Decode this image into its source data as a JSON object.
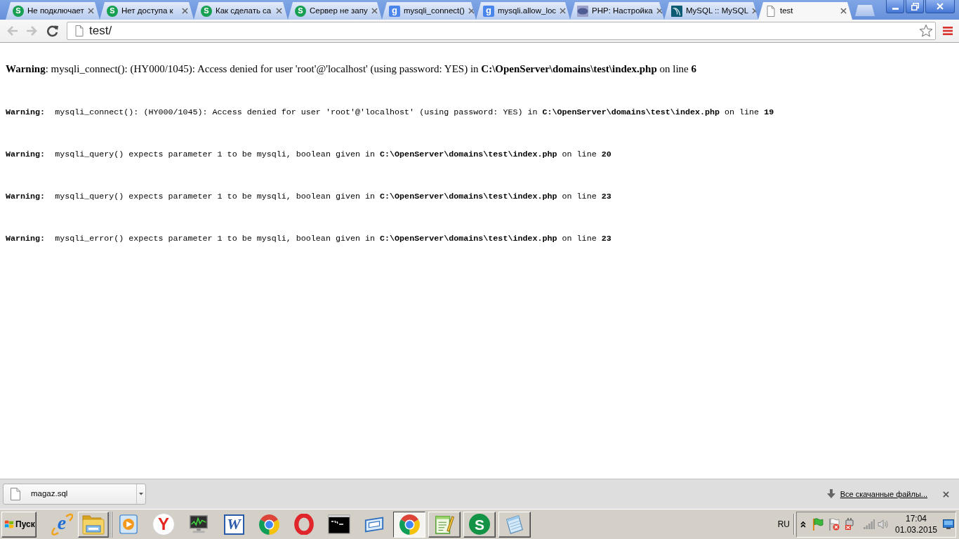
{
  "tabs": [
    {
      "title": "Не подключает",
      "favicon": {
        "kind": "badge",
        "glyph": "S"
      },
      "selected": false
    },
    {
      "title": "Нет доступа к",
      "favicon": {
        "kind": "badge",
        "glyph": "S"
      },
      "selected": false
    },
    {
      "title": "Как сделать са",
      "favicon": {
        "kind": "badge",
        "glyph": "S"
      },
      "selected": false
    },
    {
      "title": "Сервер не запу",
      "favicon": {
        "kind": "badge",
        "glyph": "S"
      },
      "selected": false
    },
    {
      "title": "mysqli_connect()",
      "favicon": {
        "kind": "tile",
        "glyph": "g"
      },
      "selected": false
    },
    {
      "title": "mysqli.allow_loc",
      "favicon": {
        "kind": "tile",
        "glyph": "g"
      },
      "selected": false
    },
    {
      "title": "PHP: Настройка",
      "favicon": {
        "kind": "oval"
      },
      "selected": false
    },
    {
      "title": "MySQL :: MySQL",
      "favicon": {
        "kind": "dolphin"
      },
      "selected": false
    },
    {
      "title": "test",
      "favicon": {
        "kind": "page"
      },
      "selected": true
    }
  ],
  "toolbar": {
    "back": {
      "disabled": true
    },
    "forward": {
      "disabled": true
    },
    "address": "test/"
  },
  "page": {
    "messages": [
      {
        "kind": "html",
        "text": "**Warning**: mysqli_connect(): (HY000/1045): Access denied for user 'root'@'localhost' (using password: YES) in **C:\\OpenServer\\domains\\test\\index.php** on line **6**"
      },
      {
        "kind": "pre",
        "text": "**Warning:**  mysqli_connect(): (HY000/1045): Access denied for user 'root'@'localhost' (using password: YES) in **C:\\OpenServer\\domains\\test\\index.php** on line **19**"
      },
      {
        "kind": "pre",
        "text": "**Warning:**  mysqli_query() expects parameter 1 to be mysqli, boolean given in **C:\\OpenServer\\domains\\test\\index.php** on line **20**"
      },
      {
        "kind": "pre",
        "text": "**Warning:**  mysqli_query() expects parameter 1 to be mysqli, boolean given in **C:\\OpenServer\\domains\\test\\index.php** on line **23**"
      },
      {
        "kind": "pre",
        "text": "**Warning:**  mysqli_error() expects parameter 1 to be mysqli, boolean given in **C:\\OpenServer\\domains\\test\\index.php** on line **23**"
      }
    ]
  },
  "download_shelf": {
    "downloads": [
      {
        "file_name": "magaz.sql"
      }
    ],
    "show_all": "Все скачанные файлы..."
  },
  "taskbar": {
    "start": "Пуск",
    "quick_launch": [
      {
        "kind": "ie",
        "glyph": "e",
        "open": false
      },
      {
        "kind": "folder",
        "open": true
      }
    ],
    "tasks": [
      {
        "kind": "media",
        "open": false,
        "selected": false
      },
      {
        "kind": "yandex",
        "glyph": "Y",
        "open": false,
        "selected": false
      },
      {
        "kind": "monitor",
        "open": false,
        "selected": false
      },
      {
        "kind": "word",
        "glyph": "W",
        "open": false,
        "selected": false
      },
      {
        "kind": "chrome",
        "open": false,
        "selected": false
      },
      {
        "kind": "opera",
        "open": false,
        "selected": false
      },
      {
        "kind": "terminal",
        "open": false,
        "selected": false
      },
      {
        "kind": "window",
        "open": false,
        "selected": false
      },
      {
        "kind": "chrome",
        "open": true,
        "selected": true
      },
      {
        "kind": "notepadpp",
        "open": true,
        "selected": false
      },
      {
        "kind": "s",
        "glyph": "S",
        "open": true,
        "selected": false
      },
      {
        "kind": "notepad",
        "open": true,
        "selected": false
      }
    ],
    "language": "RU",
    "clock": {
      "time": "17:04",
      "date": "01.03.2015"
    }
  }
}
